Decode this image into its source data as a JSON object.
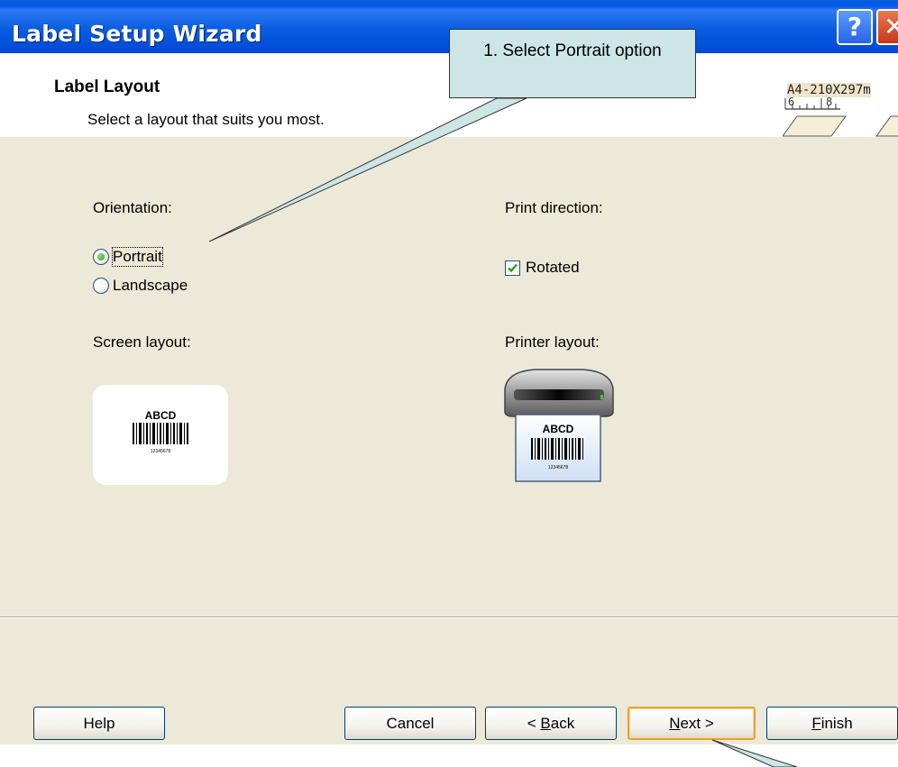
{
  "window": {
    "title": "Label Setup Wizard",
    "help_glyph": "?",
    "close_glyph": "✕"
  },
  "header": {
    "title": "Label Layout",
    "subtitle": "Select a layout that suits you most.",
    "paper_label": "A4-210X297m",
    "ruler_numbers": [
      "6",
      "8"
    ]
  },
  "orientation": {
    "label": "Orientation:",
    "options": [
      {
        "label": "Portrait",
        "selected": true
      },
      {
        "label": "Landscape",
        "selected": false
      }
    ]
  },
  "print_direction": {
    "label": "Print direction:",
    "rotated": {
      "label": "Rotated",
      "checked": true
    }
  },
  "screen_layout": {
    "label": "Screen layout:",
    "sample_text": "ABCD",
    "sample_number": "12345678"
  },
  "printer_layout": {
    "label": "Printer layout:",
    "sample_text": "ABCD",
    "sample_number": "12345678"
  },
  "buttons": {
    "help": "Help",
    "cancel": "Cancel",
    "back": "< Back",
    "next": "Next >",
    "finish": "Finish"
  },
  "callout": {
    "text": "1. Select Portrait option",
    "fill": "#cde5e5"
  },
  "colors": {
    "titlebar": "#0054E3",
    "dialog_bg": "#ECE9D8",
    "radio_dot": "#2f9b1d",
    "check_mark": "#21a121",
    "default_button_border": "#e5a336"
  }
}
